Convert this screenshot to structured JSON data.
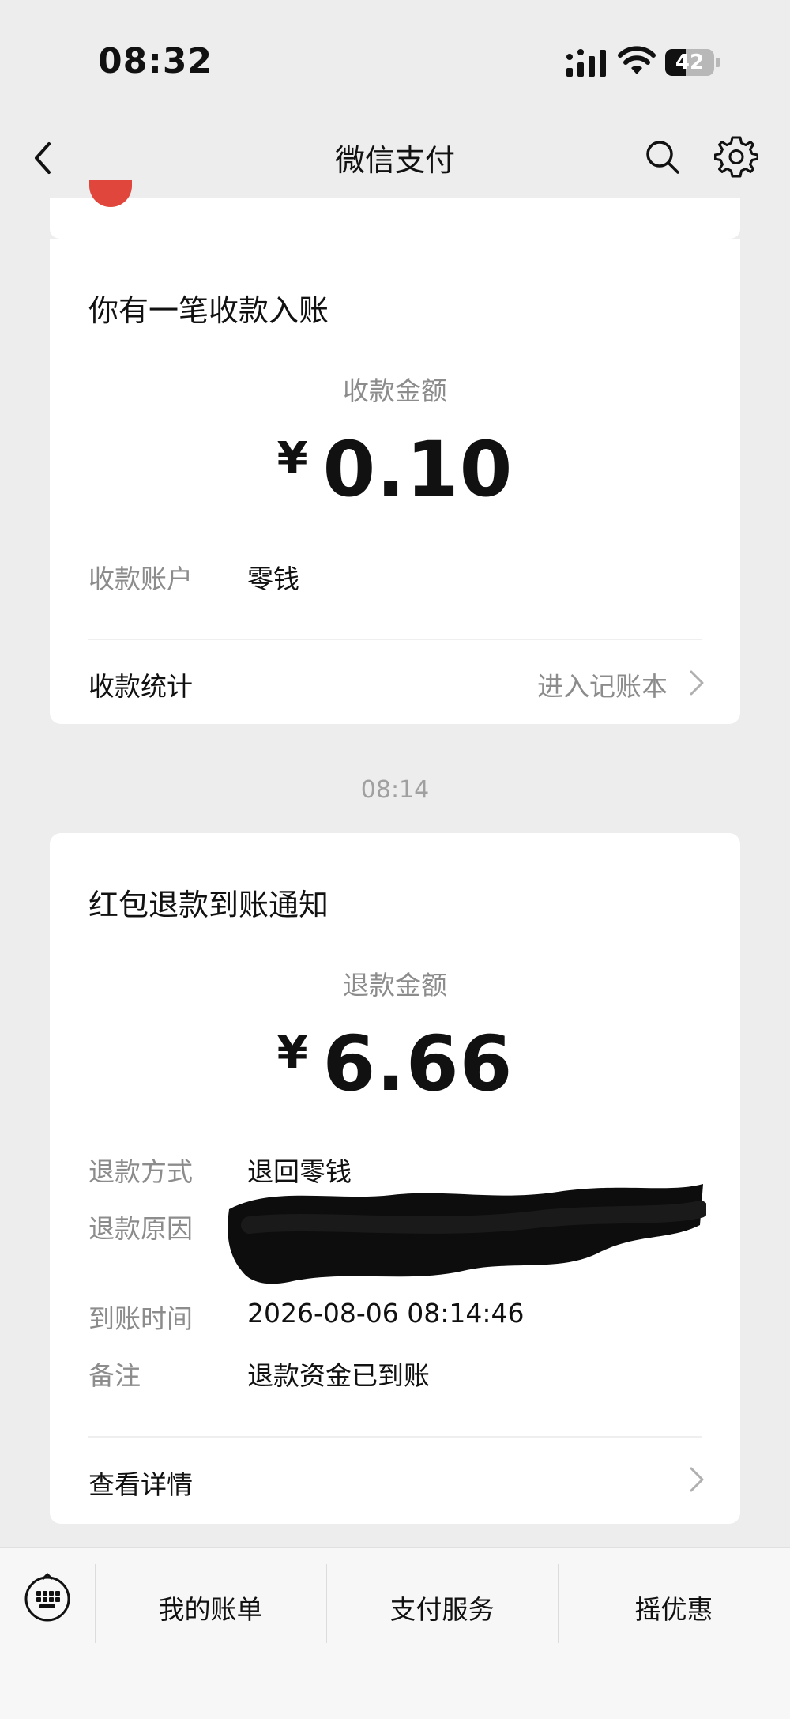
{
  "status_bar": {
    "time": "08:32",
    "battery_level": "42",
    "battery_fraction": 0.42
  },
  "nav": {
    "title": "微信支付",
    "icons": [
      "back-icon",
      "search-icon",
      "gear-icon"
    ]
  },
  "timestamp": "08:14",
  "receipt_card": {
    "title": "你有一笔收款入账",
    "amount_label": "收款金额",
    "currency": "¥",
    "amount": "0.10",
    "account_label": "收款账户",
    "account_value": "零钱",
    "footer_label": "收款统计",
    "footer_link": "进入记账本"
  },
  "refund_card": {
    "title": "红包退款到账通知",
    "amount_label": "退款金额",
    "currency": "¥",
    "amount": "6.66",
    "rows": [
      {
        "label": "退款方式",
        "value": "退回零钱"
      },
      {
        "label": "退款原因",
        "value": ""
      },
      {
        "label": "到账时间",
        "value": "2026-08-06 08:14:46"
      },
      {
        "label": "备注",
        "value": "退款资金已到账"
      }
    ],
    "footer_label": "查看详情"
  },
  "bottom_menu": {
    "items": [
      "我的账单",
      "支付服务",
      "摇优惠"
    ]
  },
  "colors": {
    "background": "#ededed",
    "card": "#ffffff",
    "secondary_text": "#8c8c8c",
    "avatar_red": "#e0463b"
  }
}
